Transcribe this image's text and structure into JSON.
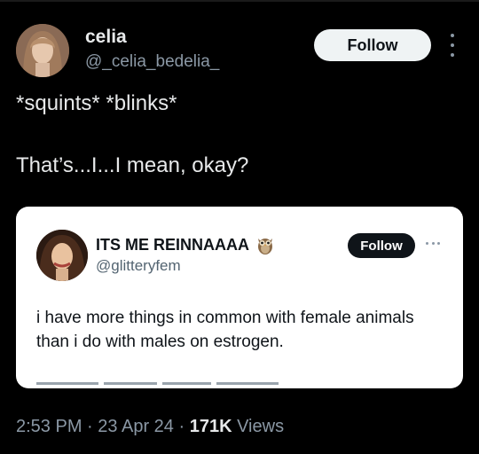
{
  "tweet": {
    "author": {
      "display_name": "celia",
      "handle": "@_celia_bedelia_"
    },
    "follow_label": "Follow",
    "more_icon": "more-vertical-icon",
    "text_line1": "*squints* *blinks*",
    "text_line2": "That’s...I...I mean, okay?",
    "timestamp_time": "2:53 PM",
    "timestamp_date": "23 Apr 24",
    "separator": "·",
    "views_count": "171K",
    "views_label": "Views"
  },
  "quoted": {
    "author": {
      "display_name": "ITS ME REINNAAAA",
      "name_emoji": "owl-icon",
      "handle": "@glitteryfem"
    },
    "follow_label": "Follow",
    "more_icon": "more-horizontal-icon",
    "text": "i have more things in common with female animals than i do with males on estrogen."
  },
  "colors": {
    "background": "#000000",
    "primary_text": "#e7e9ea",
    "secondary_text": "#8b98a5",
    "card_background": "#ffffff",
    "card_text": "#0f1419"
  }
}
